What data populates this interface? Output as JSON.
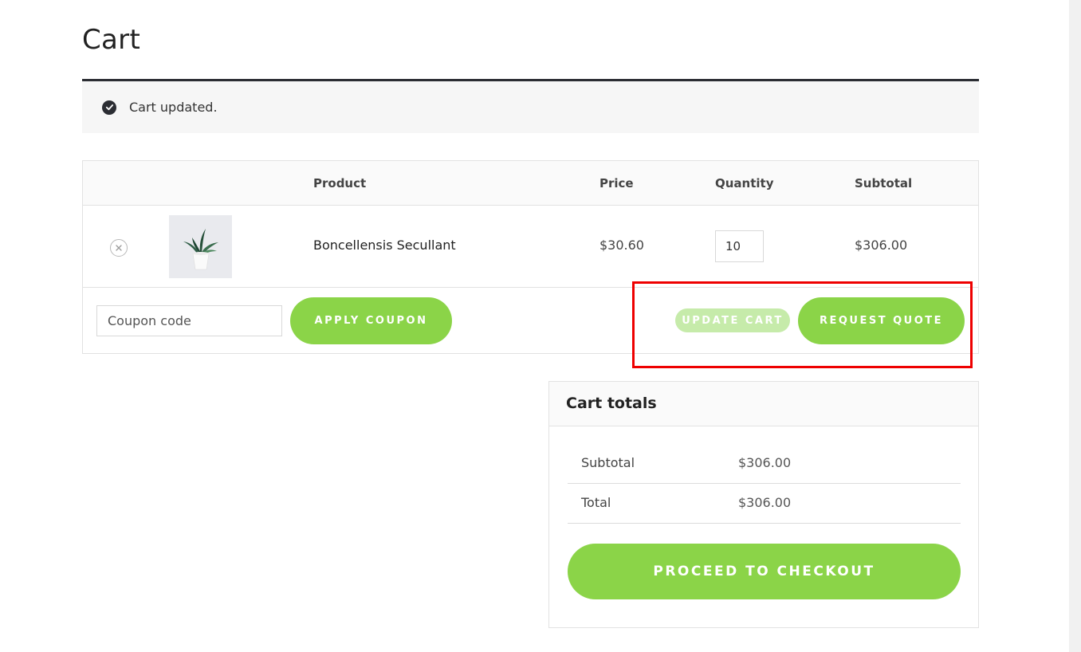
{
  "page": {
    "title": "Cart"
  },
  "notice": {
    "message": "Cart updated.",
    "icon": "check-circle-icon"
  },
  "table": {
    "headers": {
      "product": "Product",
      "price": "Price",
      "quantity": "Quantity",
      "subtotal": "Subtotal"
    },
    "items": [
      {
        "name": "Boncellensis Secullant",
        "price": "$30.60",
        "quantity": "10",
        "subtotal": "$306.00",
        "image": "potted-plant-image",
        "remove_icon": "close-circle-icon"
      }
    ]
  },
  "actions": {
    "coupon_placeholder": "Coupon code",
    "apply_coupon": "APPLY COUPON",
    "update_cart": "UPDATE CART",
    "request_quote": "REQUEST QUOTE"
  },
  "totals": {
    "title": "Cart totals",
    "rows": [
      {
        "label": "Subtotal",
        "value": "$306.00"
      },
      {
        "label": "Total",
        "value": "$306.00"
      }
    ],
    "checkout": "PROCEED TO CHECKOUT"
  },
  "colors": {
    "accent": "#8bd448",
    "accent_disabled": "#c6ebaa",
    "notice_border": "#2b2d33",
    "highlight": "#ee0000"
  }
}
